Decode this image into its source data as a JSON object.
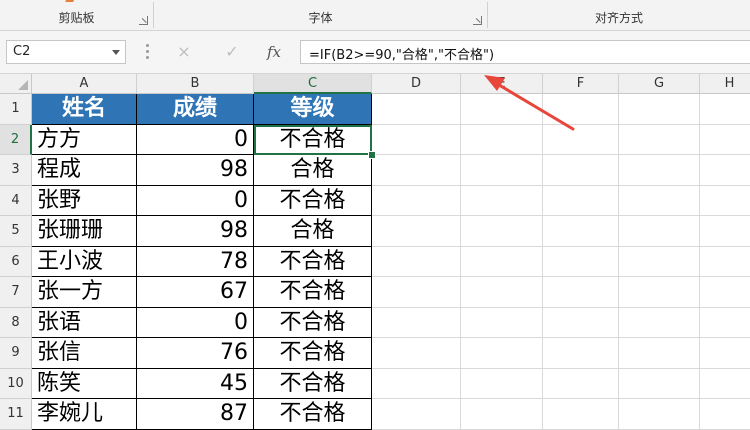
{
  "ribbon": {
    "groups": [
      "剪贴板",
      "字体",
      "对齐方式"
    ]
  },
  "formula_bar": {
    "name_box": "C2",
    "cancel_icon": "×",
    "enter_icon": "✓",
    "fx_label": "fx",
    "formula": "=IF(B2>=90,\"合格\",\"不合格\")"
  },
  "columns": [
    "A",
    "B",
    "C",
    "D",
    "E",
    "F",
    "G",
    "H"
  ],
  "rows": [
    "1",
    "2",
    "3",
    "4",
    "5",
    "6",
    "7",
    "8",
    "9",
    "10",
    "11"
  ],
  "table": {
    "headers": [
      "姓名",
      "成绩",
      "等级"
    ],
    "rows": [
      {
        "name": "方方",
        "score": "0",
        "grade": "不合格"
      },
      {
        "name": "程成",
        "score": "98",
        "grade": "合格"
      },
      {
        "name": "张野",
        "score": "0",
        "grade": "不合格"
      },
      {
        "name": "张珊珊",
        "score": "98",
        "grade": "合格"
      },
      {
        "name": "王小波",
        "score": "78",
        "grade": "不合格"
      },
      {
        "name": "张一方",
        "score": "67",
        "grade": "不合格"
      },
      {
        "name": "张语",
        "score": "0",
        "grade": "不合格"
      },
      {
        "name": "张信",
        "score": "76",
        "grade": "不合格"
      },
      {
        "name": "陈笑",
        "score": "45",
        "grade": "不合格"
      },
      {
        "name": "李婉儿",
        "score": "87",
        "grade": "不合格"
      }
    ]
  },
  "colors": {
    "header_fill": "#2f75b5",
    "selection_green": "#217346",
    "annotation_arrow": "#e8463a"
  }
}
